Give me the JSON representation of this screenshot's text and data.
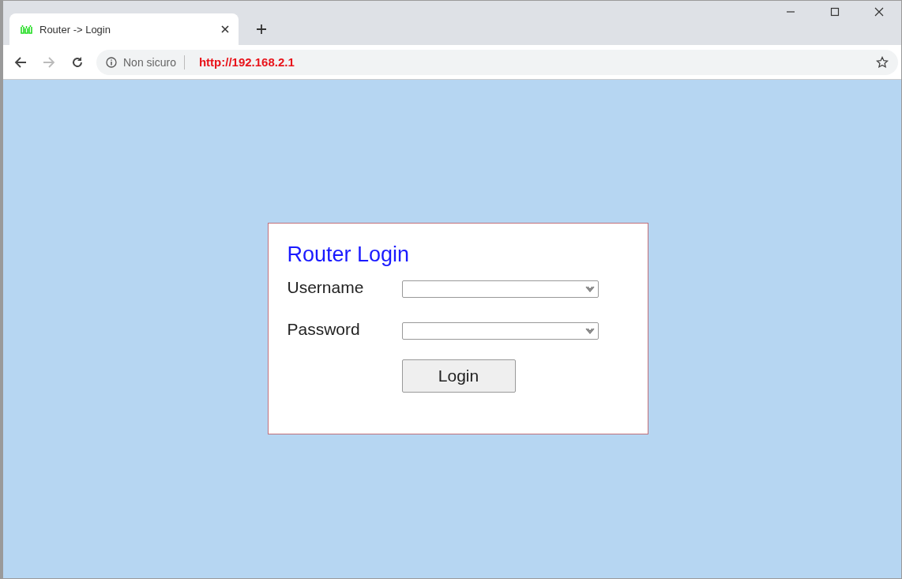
{
  "browser": {
    "tab": {
      "title": "Router -> Login",
      "selected": true
    },
    "security_label": "Non sicuro",
    "url": "http://192.168.2.1"
  },
  "login": {
    "title": "Router Login",
    "fields": [
      {
        "label": "Username"
      },
      {
        "label": "Password"
      }
    ],
    "button": "Login"
  }
}
